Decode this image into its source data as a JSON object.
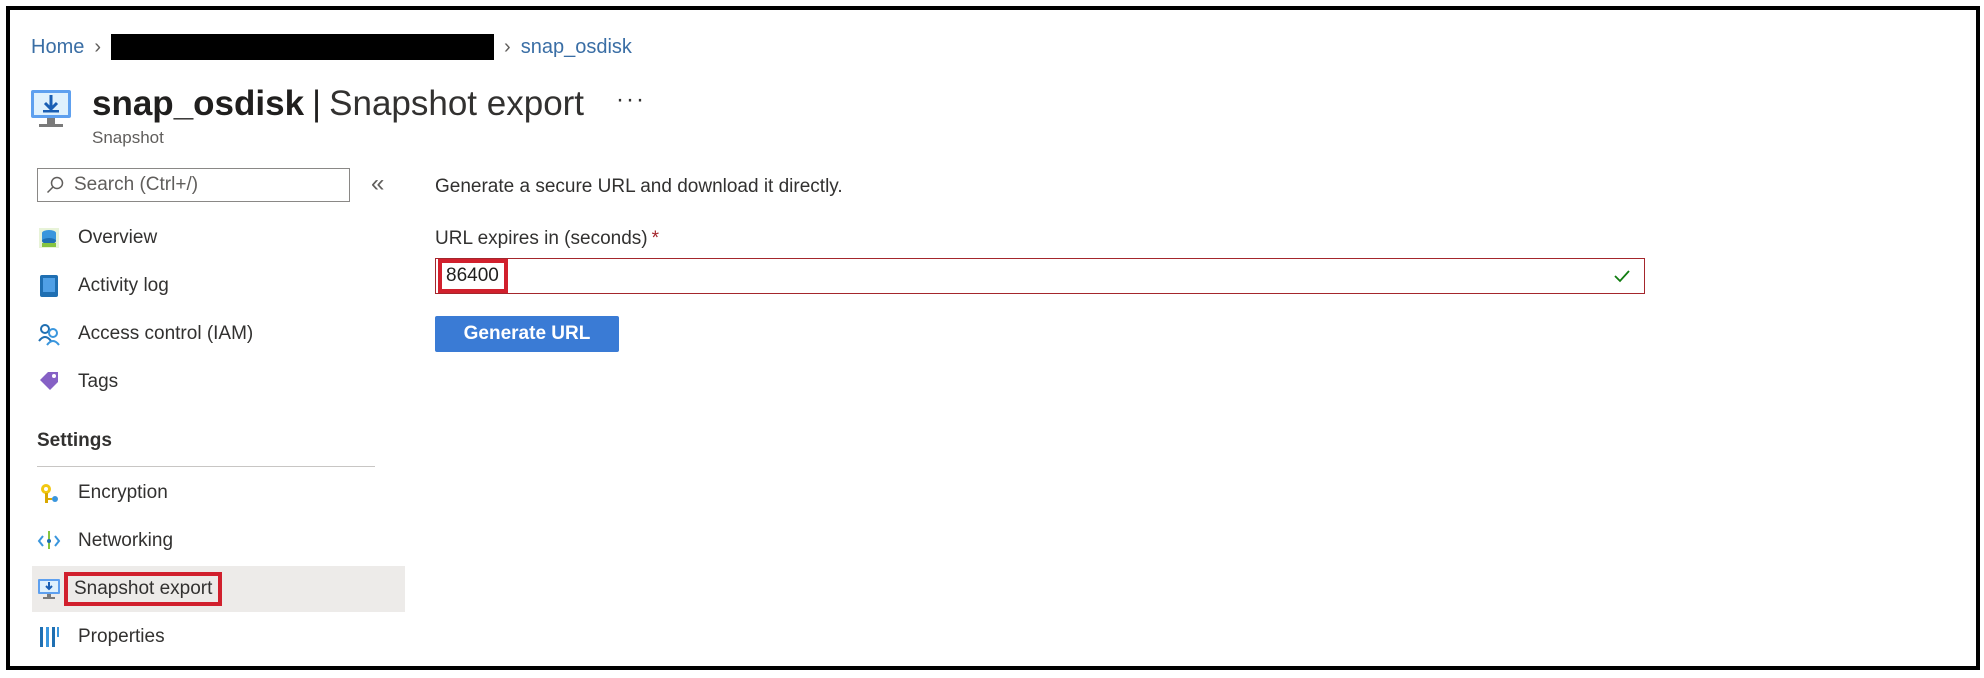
{
  "breadcrumb": {
    "home": "Home",
    "current": "snap_osdisk"
  },
  "header": {
    "resource_name": "snap_osdisk",
    "separator": "|",
    "blade_name": "Snapshot export",
    "more": "···",
    "resource_type": "Snapshot"
  },
  "sidebar": {
    "search_placeholder": "Search (Ctrl+/)",
    "collapse": "«",
    "items": [
      {
        "label": "Overview",
        "icon": "overview-icon"
      },
      {
        "label": "Activity log",
        "icon": "activity-log-icon"
      },
      {
        "label": "Access control (IAM)",
        "icon": "iam-icon"
      },
      {
        "label": "Tags",
        "icon": "tag-icon"
      }
    ],
    "settings_header": "Settings",
    "settings_items": [
      {
        "label": "Encryption",
        "icon": "key-icon"
      },
      {
        "label": "Networking",
        "icon": "networking-icon"
      },
      {
        "label": "Snapshot export",
        "icon": "snapshot-export-icon",
        "selected": true
      },
      {
        "label": "Properties",
        "icon": "properties-icon"
      }
    ]
  },
  "main": {
    "description": "Generate a secure URL and download it directly.",
    "field_label": "URL expires in (seconds)",
    "required_marker": "*",
    "field_value": "86400",
    "generate_button": "Generate URL"
  },
  "colors": {
    "link": "#3a6ea5",
    "primary_button": "#3a7bd5",
    "highlight": "#d1202d",
    "selected_bg": "#edebe9",
    "valid_check": "#107c10"
  }
}
